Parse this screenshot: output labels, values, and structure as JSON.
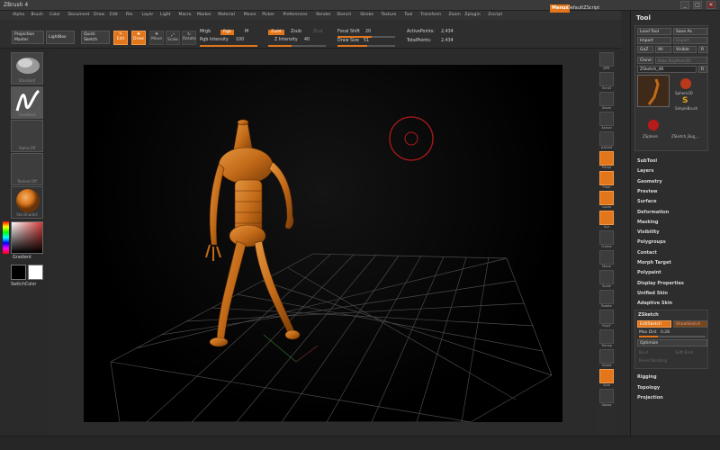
{
  "titlebar": {
    "title": "ZBrush 4",
    "minimize": "_",
    "maximize": "□",
    "close": "✕"
  },
  "menu": [
    "Alpha",
    "Brush",
    "Color",
    "Document",
    "Draw",
    "Edit",
    "File",
    "Layer",
    "Light",
    "Macro",
    "Marker",
    "Material",
    "Movie",
    "Picker",
    "Preferences",
    "Render",
    "Stencil",
    "Stroke",
    "Texture",
    "Tool",
    "Transform",
    "Zoom",
    "Zplugin",
    "Zscript"
  ],
  "menus_button": "Menus",
  "script_label": "DefaultZScript",
  "toolbar": {
    "projection_master": "Projection Master",
    "lightbox": "LightBox",
    "quick_sketch": "Quick Sketch",
    "edit": "Edit",
    "draw": "Draw",
    "move": "Move",
    "scale": "Scale",
    "rotate": "Rotate",
    "mrgb": "Mrgb",
    "rgb": "Rgb",
    "m": "M",
    "zadd": "Zadd",
    "zsub": "Zsub",
    "zcut": "Zcut",
    "rgb_intensity_label": "Rgb Intensity",
    "rgb_intensity_value": "100",
    "z_intensity_label": "Z Intensity",
    "z_intensity_value": "40",
    "focal_shift_label": "Focal Shift",
    "focal_shift_value": "20",
    "draw_size_label": "Draw Size",
    "draw_size_value": "51",
    "active_points_label": "ActivePoints:",
    "active_points_value": "2,434",
    "total_points_label": "TotalPoints:",
    "total_points_value": "2,434"
  },
  "left": {
    "brush_caption": "Standard",
    "stroke_caption": "FreeHand",
    "alpha_caption": "Alpha Off",
    "texture_caption": "Texture Off",
    "material_caption": "SkinShade4",
    "gradient": "Gradient",
    "switch_color": "SwitchColor"
  },
  "vtools": [
    {
      "label": "BPR",
      "on": false
    },
    {
      "label": "Scroll",
      "on": false
    },
    {
      "label": "Zoom",
      "on": false
    },
    {
      "label": "Actual",
      "on": false
    },
    {
      "label": "AAHalf",
      "on": false
    },
    {
      "label": "Persp",
      "on": true
    },
    {
      "label": "Floor",
      "on": true
    },
    {
      "label": "Local",
      "on": true
    },
    {
      "label": "Xyz",
      "on": true
    },
    {
      "label": "Frame",
      "on": false
    },
    {
      "label": "Move",
      "on": false
    },
    {
      "label": "Scale",
      "on": false
    },
    {
      "label": "Rotate",
      "on": false
    },
    {
      "label": "PolyF",
      "on": false
    },
    {
      "label": "Transp",
      "on": false
    },
    {
      "label": "Ghost",
      "on": false
    },
    {
      "label": "Solo",
      "on": true
    },
    {
      "label": "Xpose",
      "on": false
    }
  ],
  "tool_panel": {
    "title": "Tool",
    "load_tool": "Load Tool",
    "save_as": "Save As",
    "import": "Import",
    "export": "Export",
    "goz": "GoZ",
    "all": "All",
    "visible": "Visible",
    "r": "R",
    "clone": "Clone",
    "make_polymesh": "Make PolyMesh3D",
    "current_tool": "ZSketch_46",
    "sphere3d": "Sphere3D",
    "simplebrush": "SimpleBrush",
    "zsphere": "ZSphere",
    "zsketch_tool": "ZSketch_Bug_...",
    "sections": [
      "SubTool",
      "Layers",
      "Geometry",
      "Preview",
      "Surface",
      "Deformation",
      "Masking",
      "Visibility",
      "Polygroups",
      "Contact",
      "Morph Target",
      "Polypaint",
      "Display Properties",
      "Unified Skin",
      "Adaptive Skin"
    ],
    "zsketch": {
      "header": "ZSketch",
      "edit_sketch": "EditSketch",
      "show_sketch": "ShowSketch",
      "max_dist_label": "Max Dist",
      "max_dist_value": "0.28",
      "optimize": "Optimize",
      "bind": "Bind",
      "soft_bind": "Soft Bind",
      "reset_binding": "Reset Binding"
    },
    "bottom_sections": [
      "Rigging",
      "Topology",
      "Projection"
    ]
  },
  "colors": {
    "accent": "#e3761b",
    "model": "#c8721f",
    "panel": "#2d2d2d"
  }
}
